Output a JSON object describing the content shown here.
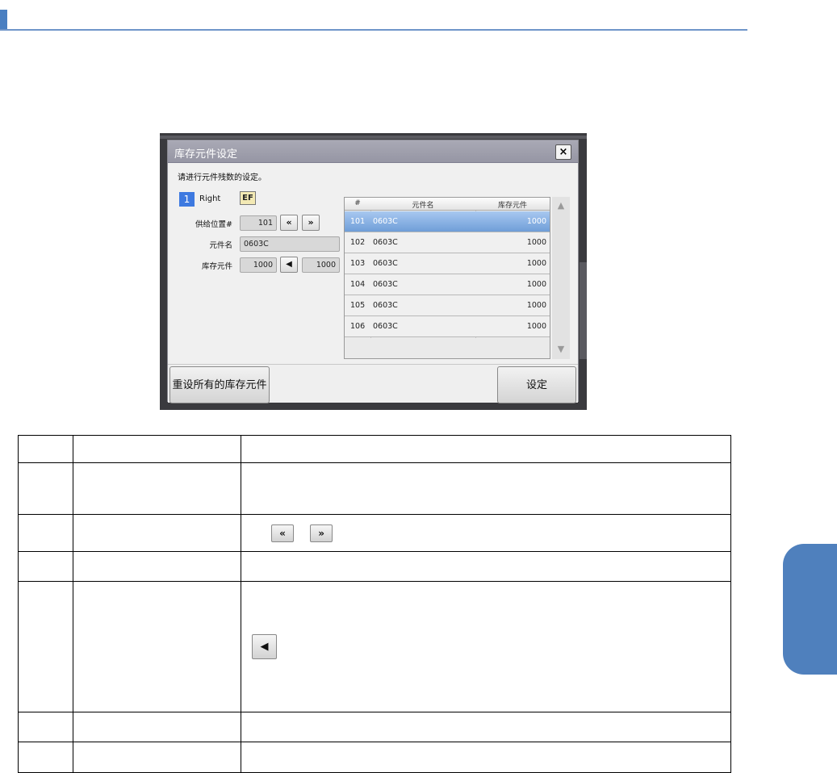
{
  "dialog": {
    "title": "库存元件设定",
    "close_label": "×",
    "instruction": "请进行元件残数的设定。",
    "feeder_number": "1",
    "feeder_side": "Right",
    "ef_badge": "EF",
    "supply_position_label": "供给位置#",
    "supply_position_value": "101",
    "prev_label": "«",
    "next_label": "»",
    "part_name_label": "元件名",
    "part_name_value": "0603C",
    "stock_label": "库存元件",
    "stock_current": "1000",
    "stock_arrow": "◀",
    "stock_new": "1000",
    "grid": {
      "headers": [
        "#",
        "元件名",
        "库存元件"
      ],
      "rows": [
        {
          "no": "101",
          "name": "0603C",
          "qty": "1000"
        },
        {
          "no": "102",
          "name": "0603C",
          "qty": "1000"
        },
        {
          "no": "103",
          "name": "0603C",
          "qty": "1000"
        },
        {
          "no": "104",
          "name": "0603C",
          "qty": "1000"
        },
        {
          "no": "105",
          "name": "0603C",
          "qty": "1000"
        },
        {
          "no": "106",
          "name": "0603C",
          "qty": "1000"
        }
      ],
      "selected_row": 0
    },
    "reset_all_label": "重设所有的库存元件",
    "set_label": "设定"
  },
  "table": {
    "prev_icon": "«",
    "next_icon": "»",
    "arrow_icon": "◀"
  },
  "colors": {
    "accent": "#4f80bd",
    "selected_row": "#6f9ed8",
    "title_bar": "#9d9dab"
  }
}
